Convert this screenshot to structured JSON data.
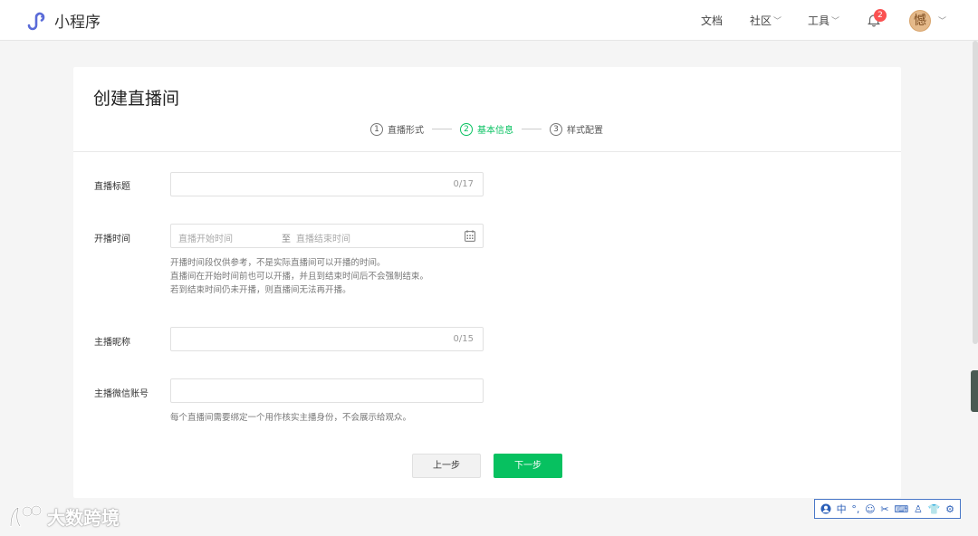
{
  "header": {
    "app_name": "小程序",
    "nav": [
      {
        "label": "文档",
        "has_dropdown": false
      },
      {
        "label": "社区",
        "has_dropdown": true
      },
      {
        "label": "工具",
        "has_dropdown": true
      }
    ],
    "notification_count": "2",
    "avatar_glyph": "憾",
    "accent_color": "#07c160"
  },
  "card": {
    "title": "创建直播间",
    "steps": [
      {
        "num": "1",
        "label": "直播形式",
        "active": false
      },
      {
        "num": "2",
        "label": "基本信息",
        "active": true
      },
      {
        "num": "3",
        "label": "样式配置",
        "active": false
      }
    ]
  },
  "form": {
    "title_label": "直播标题",
    "title_value": "",
    "title_counter": "0/17",
    "time_label": "开播时间",
    "time_start_placeholder": "直播开始时间",
    "time_separator": "至",
    "time_end_placeholder": "直播结束时间",
    "time_hints": [
      "开播时间段仅供参考，不是实际直播间可以开播的时间。",
      "直播间在开始时间前也可以开播，并且到结束时间后不会强制结束。",
      "若到结束时间仍未开播，则直播间无法再开播。"
    ],
    "nickname_label": "主播昵称",
    "nickname_value": "",
    "nickname_counter": "0/15",
    "wechat_label": "主播微信账号",
    "wechat_value": "",
    "wechat_hint": "每个直播间需要绑定一个用作核实主播身份，不会展示给观众。"
  },
  "buttons": {
    "prev": "上一步",
    "next": "下一步"
  },
  "watermark": {
    "text": "大数跨境"
  },
  "ime_toolbar": {
    "mode": "中",
    "items": [
      "°,",
      "☺",
      "✂",
      "⌨",
      "♙",
      "👕",
      "⚙"
    ]
  }
}
